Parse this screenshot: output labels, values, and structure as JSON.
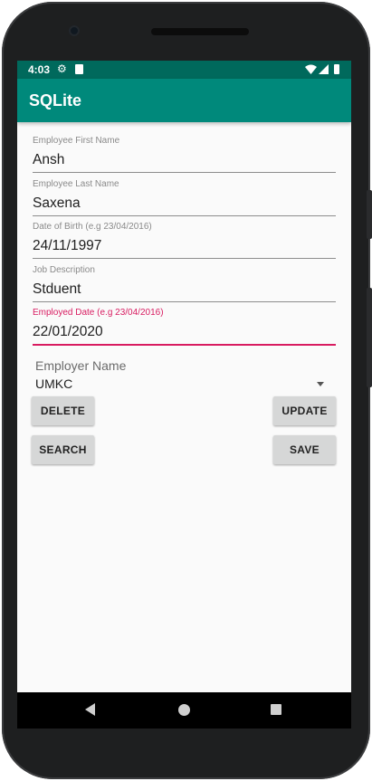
{
  "status_bar": {
    "time": "4:03",
    "icons": [
      "gear-icon",
      "sd-card-icon",
      "wifi-icon",
      "signal-icon",
      "battery-icon"
    ]
  },
  "app_bar": {
    "title": "SQLite"
  },
  "form": {
    "first_name": {
      "label": "Employee First Name",
      "value": "Ansh"
    },
    "last_name": {
      "label": "Employee Last Name",
      "value": "Saxena"
    },
    "dob": {
      "label": "Date of Birth (e.g 23/04/2016)",
      "value": "24/11/1997"
    },
    "job": {
      "label": "Job Description",
      "value": "Stduent"
    },
    "employed": {
      "label": "Employed Date (e.g 23/04/2016)",
      "value": "22/01/2020"
    }
  },
  "employer": {
    "label": "Employer Name",
    "selected": "UMKC"
  },
  "buttons": {
    "delete": "DELETE",
    "update": "UPDATE",
    "search": "SEARCH",
    "save": "SAVE"
  },
  "nav": {
    "icons": [
      "back-icon",
      "home-icon",
      "recents-icon"
    ]
  },
  "colors": {
    "primary": "#00897b",
    "primary_dark": "#00695c",
    "accent": "#d81b60"
  }
}
